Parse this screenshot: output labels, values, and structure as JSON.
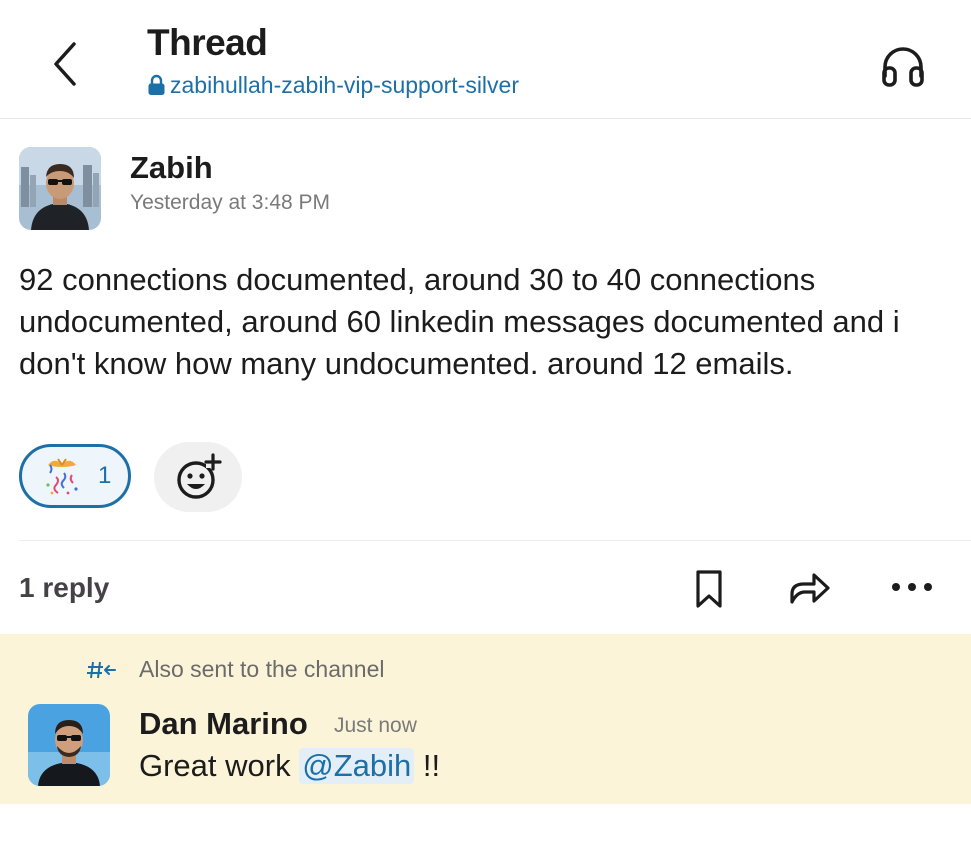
{
  "header": {
    "title": "Thread",
    "channel_name": "zabihullah-zabih-vip-support-silver",
    "icons": {
      "back": "chevron-left-icon",
      "lock": "lock-icon",
      "huddle": "headphones-icon"
    }
  },
  "message": {
    "author": "Zabih",
    "timestamp": "Yesterday at 3:48 PM",
    "text": "92 connections documented, around 30 to 40 connections undocumented, around 60 linkedin messages documented and i don't know how many undocumented. around 12 emails.",
    "reactions": [
      {
        "emoji": "confetti-ball-icon",
        "count": "1"
      }
    ],
    "add_reaction_icon": "add-emoji-icon"
  },
  "thread_bar": {
    "reply_count": "1 reply",
    "actions": [
      "bookmark-icon",
      "share-forward-icon",
      "more-horizontal-icon"
    ]
  },
  "reply": {
    "also_sent_label": "Also sent to the channel",
    "author": "Dan Marino",
    "timestamp": "Just now",
    "text_before": "Great work ",
    "mention": "@Zabih",
    "text_after": " !!"
  },
  "colors": {
    "link_blue": "#1d6fa8",
    "highlight_yellow": "#fcf4d8",
    "mention_bg": "#e3eef6",
    "muted_text": "#7a7a7a"
  }
}
